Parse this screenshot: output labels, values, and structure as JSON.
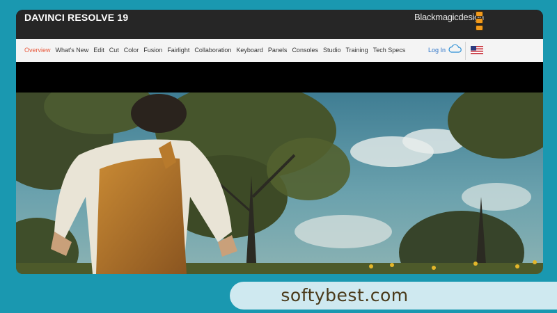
{
  "header": {
    "product_title": "DAVINCI RESOLVE 19",
    "brand": "Blackmagicdesign",
    "brand_color": "#f29a1b"
  },
  "nav": {
    "items": [
      {
        "label": "Overview",
        "active": true
      },
      {
        "label": "What's New"
      },
      {
        "label": "Edit"
      },
      {
        "label": "Cut"
      },
      {
        "label": "Color"
      },
      {
        "label": "Fusion"
      },
      {
        "label": "Fairlight"
      },
      {
        "label": "Collaboration"
      },
      {
        "label": "Keyboard"
      },
      {
        "label": "Panels"
      },
      {
        "label": "Consoles"
      },
      {
        "label": "Studio"
      },
      {
        "label": "Training"
      },
      {
        "label": "Tech Specs"
      }
    ],
    "login_label": "Log In",
    "active_color": "#e8593c",
    "cloud_icon": "cloud-icon",
    "flag_icon": "us-flag-icon"
  },
  "hero": {
    "description": "Film still: person in mustard overalls among trees under a blue sky with clouds"
  },
  "watermark": {
    "text": "softybest.com"
  }
}
